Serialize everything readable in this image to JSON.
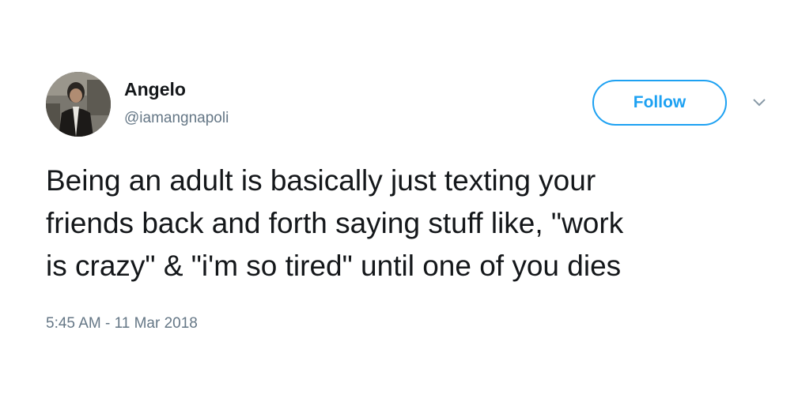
{
  "user": {
    "name": "Angelo",
    "handle": "@iamangnapoli"
  },
  "follow_button": {
    "label": "Follow"
  },
  "more_menu": {
    "icon": "chevron-down-icon"
  },
  "tweet": {
    "lines": [
      "Being an adult is basically just texting your",
      "friends back and forth saying stuff like, \"work",
      "is crazy\" & \"i'm so tired\" until one of you dies"
    ],
    "timestamp": "5:45 AM - 11 Mar 2018"
  },
  "colors": {
    "brand_blue": "#1da1f2",
    "text_primary": "#14171a",
    "text_secondary": "#657786"
  }
}
